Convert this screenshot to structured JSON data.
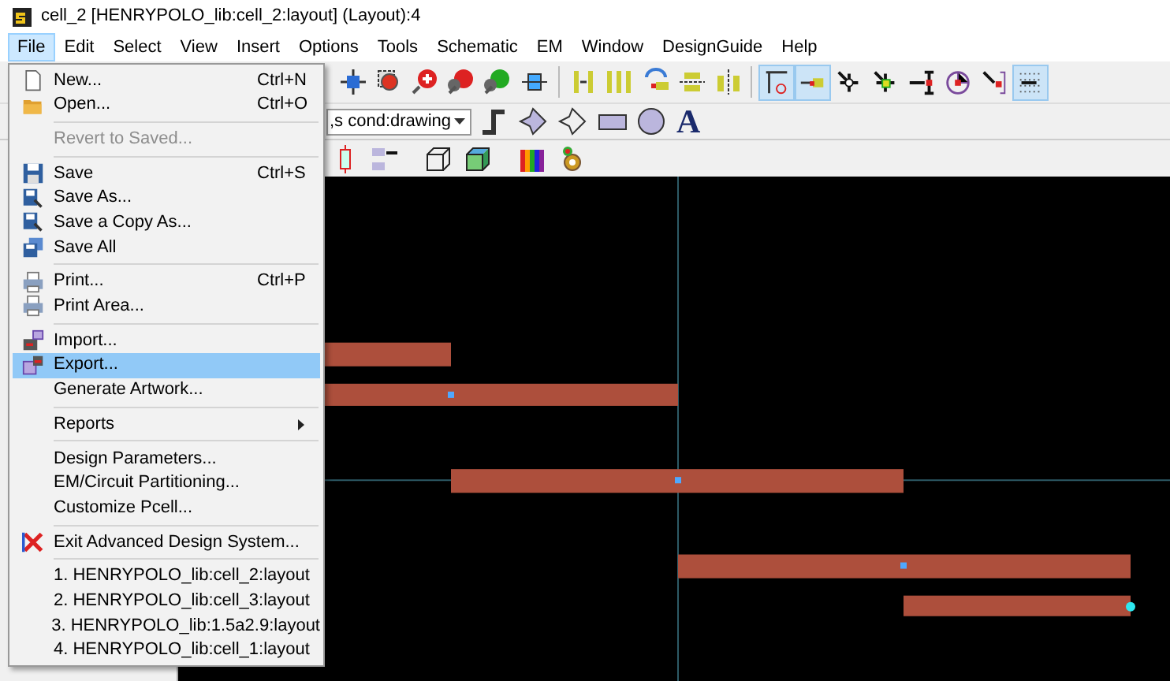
{
  "window": {
    "title": "cell_2 [HENRYPOLO_lib:cell_2:layout] (Layout):4"
  },
  "menubar": [
    {
      "label": "File",
      "selected": true
    },
    {
      "label": "Edit",
      "selected": false
    },
    {
      "label": "Select",
      "selected": false
    },
    {
      "label": "View",
      "selected": false
    },
    {
      "label": "Insert",
      "selected": false
    },
    {
      "label": "Options",
      "selected": false
    },
    {
      "label": "Tools",
      "selected": false
    },
    {
      "label": "Schematic",
      "selected": false
    },
    {
      "label": "EM",
      "selected": false
    },
    {
      "label": "Window",
      "selected": false
    },
    {
      "label": "DesignGuide",
      "selected": false
    },
    {
      "label": "Help",
      "selected": false
    }
  ],
  "toolbar": {
    "snap_buttons": [
      {
        "selected": true
      },
      {
        "selected": true
      },
      {
        "selected": false
      },
      {
        "selected": false
      },
      {
        "selected": false
      },
      {
        "selected": false
      },
      {
        "selected": false
      },
      {
        "selected": true
      }
    ],
    "layer_dropdown": {
      "value": ",s cond:drawing"
    },
    "text_tool": "A"
  },
  "file_menu": [
    {
      "kind": "item",
      "label": "New...",
      "shortcut": "Ctrl+N",
      "disabled": false,
      "selected": false
    },
    {
      "kind": "item",
      "label": "Open...",
      "shortcut": "Ctrl+O",
      "disabled": false,
      "selected": false
    },
    {
      "kind": "separator"
    },
    {
      "kind": "item",
      "label": "Revert to Saved...",
      "disabled": true,
      "selected": false
    },
    {
      "kind": "separator"
    },
    {
      "kind": "item",
      "label": "Save",
      "shortcut": "Ctrl+S",
      "disabled": false,
      "selected": false
    },
    {
      "kind": "item",
      "label": "Save As...",
      "disabled": false,
      "selected": false
    },
    {
      "kind": "item",
      "label": "Save a Copy As...",
      "disabled": false,
      "selected": false
    },
    {
      "kind": "item",
      "label": "Save All",
      "disabled": false,
      "selected": false
    },
    {
      "kind": "separator"
    },
    {
      "kind": "item",
      "label": "Print...",
      "shortcut": "Ctrl+P",
      "disabled": false,
      "selected": false
    },
    {
      "kind": "item",
      "label": "Print Area...",
      "disabled": false,
      "selected": false
    },
    {
      "kind": "separator"
    },
    {
      "kind": "item",
      "label": "Import...",
      "disabled": false,
      "selected": false
    },
    {
      "kind": "item",
      "label": "Export...",
      "disabled": false,
      "selected": true
    },
    {
      "kind": "item",
      "label": "Generate Artwork...",
      "disabled": false,
      "selected": false
    },
    {
      "kind": "separator"
    },
    {
      "kind": "item",
      "label": "Reports",
      "submenu": true,
      "disabled": false,
      "selected": false
    },
    {
      "kind": "separator"
    },
    {
      "kind": "item",
      "label": "Design Parameters...",
      "disabled": false,
      "selected": false
    },
    {
      "kind": "item",
      "label": "EM/Circuit Partitioning...",
      "disabled": false,
      "selected": false
    },
    {
      "kind": "item",
      "label": "Customize Pcell...",
      "disabled": false,
      "selected": false
    },
    {
      "kind": "separator"
    },
    {
      "kind": "item",
      "label": "Exit Advanced Design System...",
      "disabled": false,
      "selected": false
    },
    {
      "kind": "separator"
    },
    {
      "kind": "item",
      "label": "1. HENRYPOLO_lib:cell_2:layout",
      "disabled": false,
      "selected": false
    },
    {
      "kind": "item",
      "label": "2. HENRYPOLO_lib:cell_3:layout",
      "disabled": false,
      "selected": false
    },
    {
      "kind": "item",
      "label": "3. HENRYPOLO_lib:1.5a2.9:layout",
      "disabled": false,
      "selected": false
    },
    {
      "kind": "item",
      "label": "4. HENRYPOLO_lib:cell_1:layout",
      "disabled": false,
      "selected": false
    }
  ]
}
